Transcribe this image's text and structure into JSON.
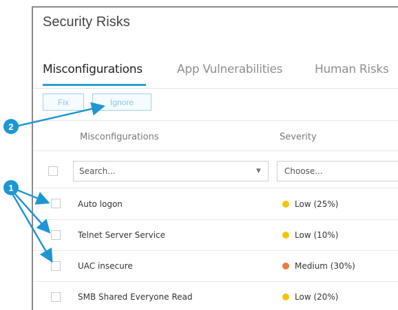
{
  "page": {
    "title": "Security Risks"
  },
  "tabs": [
    {
      "label": "Misconfigurations",
      "active": true
    },
    {
      "label": "App Vulnerabilities",
      "active": false
    },
    {
      "label": "Human Risks",
      "active": false
    }
  ],
  "toolbar": {
    "fix_label": "Fix",
    "ignore_label": "Ignore"
  },
  "table": {
    "columns": [
      "Misconfigurations",
      "Severity"
    ],
    "filters": {
      "search_placeholder": "Search...",
      "severity_placeholder": "Choose..."
    },
    "rows": [
      {
        "name": "Auto logon",
        "severity": "Low (25%)",
        "color": "#f2c500"
      },
      {
        "name": "Telnet Server Service",
        "severity": "Low (10%)",
        "color": "#f2c500"
      },
      {
        "name": "UAC insecure",
        "severity": "Medium (30%)",
        "color": "#f07b3a"
      },
      {
        "name": "SMB Shared Everyone Read",
        "severity": "Low (20%)",
        "color": "#f2c500"
      }
    ]
  },
  "callouts": {
    "badge_1": "1",
    "badge_2": "2"
  }
}
